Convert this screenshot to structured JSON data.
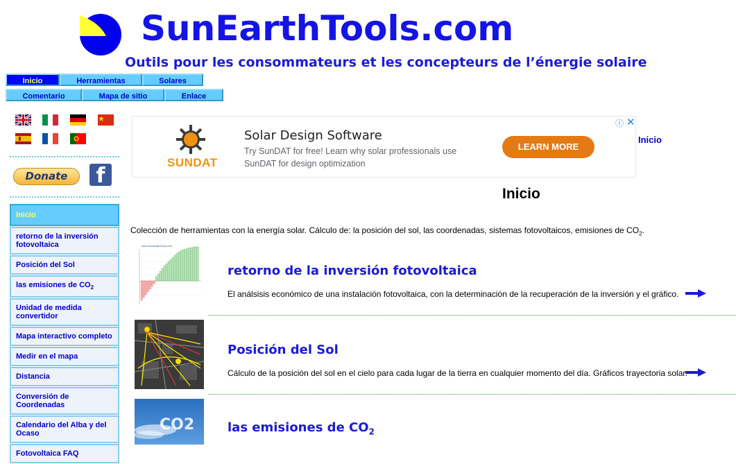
{
  "header": {
    "site_title": "SunEarthTools.com",
    "tagline": "Outils pour les consommateurs et les concepteurs de l’énergie solaire"
  },
  "top_nav": [
    {
      "label": "Inicio",
      "active": true
    },
    {
      "label": "Herramientas",
      "active": false
    },
    {
      "label": "Solares",
      "active": false
    },
    {
      "label": "Comentario",
      "active": false
    },
    {
      "label": "Mapa de sitio",
      "active": false
    },
    {
      "label": "Enlace",
      "active": false
    }
  ],
  "languages": [
    "english-flag",
    "italian-flag",
    "german-flag",
    "chinese-flag",
    "spanish-flag",
    "french-flag",
    "portuguese-flag"
  ],
  "donate": {
    "label": "Donate"
  },
  "facebook": {
    "glyph": "f"
  },
  "sidebar": {
    "items": [
      {
        "label": "Inicio",
        "active": true
      },
      {
        "label": "retorno de la inversión fotovoltaica"
      },
      {
        "label": "Posición del Sol"
      },
      {
        "label": "las emisiones de CO",
        "sub": "2"
      },
      {
        "label": "Unidad de medida convertidor"
      },
      {
        "label": "Mapa interactivo completo"
      },
      {
        "label": "Medir en el mapa"
      },
      {
        "label": "Distancia"
      },
      {
        "label": "Conversión de Coordenadas"
      },
      {
        "label": "Calendario del Alba y del Ocaso"
      },
      {
        "label": "Fotovoltaica FAQ"
      }
    ]
  },
  "ad": {
    "brand": "SUNDAT",
    "title": "Solar Design Software",
    "description": "Try SunDAT for free! Learn why solar professionals use SunDAT for design optimization",
    "cta": "LEARN MORE",
    "info_icon": "ⓘ",
    "close_icon": "✕"
  },
  "right_link": "Inicio",
  "page_heading": "Inicio",
  "intro": {
    "text": "Colección de herramientas con la energía solar. Cálculo de: la posición del sol, las coordenadas, sistemas fotovoltaicos, emisiones de CO",
    "sub": "2",
    "suffix": "."
  },
  "items": [
    {
      "title": "retorno de la inversión fotovoltaica",
      "description": "El análsisis económico de una instalación fotovoltaica, con la determinación de la recuperación de la inversión y el gráfico."
    },
    {
      "title": "Posición del Sol",
      "description": "Cálculo de la posición del sol en el cielo para cada lugar de la tierra en cualquier momento del día. Gráficos trayectoria solar."
    },
    {
      "title": "las emisiones de CO",
      "title_sub": "2",
      "description": ""
    }
  ],
  "thumbs": {
    "chart_label": "www.SunEarthTools.com",
    "co2_text": "CO2"
  },
  "colors": {
    "title_blue": "#1414e6",
    "nav_bg": "#66ccff",
    "nav_active": "#0000ff",
    "ad_button": "#e37a14"
  }
}
